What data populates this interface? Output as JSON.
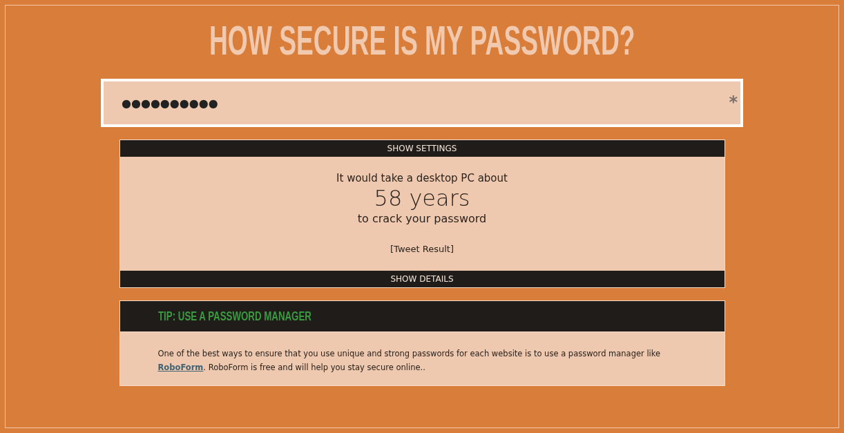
{
  "title": "HOW SECURE IS MY PASSWORD?",
  "password_field": {
    "value": "●●●●●●●●●●",
    "marker": "*"
  },
  "settings_toggle": "SHOW SETTINGS",
  "result": {
    "intro": "It would take a desktop PC about",
    "time": "58 years",
    "outro": "to crack your password",
    "tweet_link": "[Tweet Result]"
  },
  "details_toggle": "SHOW DETAILS",
  "tip": {
    "heading": "TIP: USE A PASSWORD MANAGER",
    "text_before": "One of the best ways to ensure that you use unique and strong passwords for each website is to use a password manager like ",
    "link": "RoboForm",
    "text_after": ". RoboForm is free and will help you stay secure online.."
  }
}
